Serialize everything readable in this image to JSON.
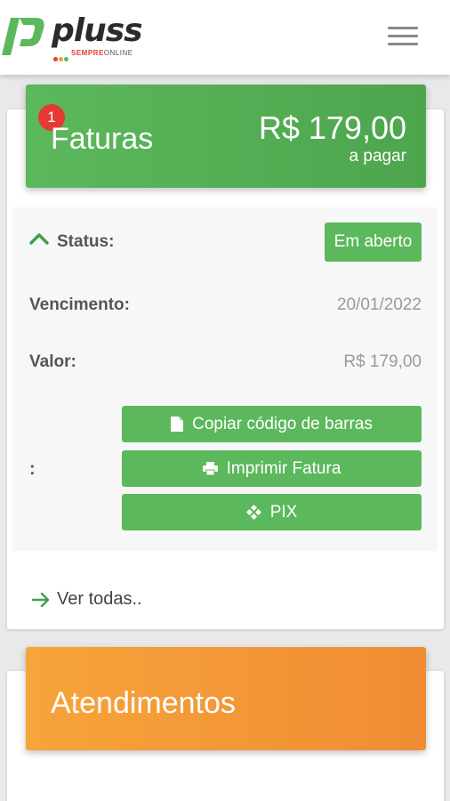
{
  "header": {
    "logo_text": "pluss",
    "logo_tagline_bold": "SEMPRE",
    "logo_tagline": "ONLINE",
    "brand_colors": {
      "green": "#5cb85c",
      "dark": "#2b2b2b",
      "red": "#e53935",
      "orange": "#f08c34"
    }
  },
  "faturas": {
    "badge_count": "1",
    "title": "Faturas",
    "amount": "R$ 179,00",
    "amount_sub": "a pagar",
    "status_label": "Status:",
    "status_value": "Em aberto",
    "vencimento_label": "Vencimento:",
    "vencimento_value": "20/01/2022",
    "valor_label": "Valor:",
    "valor_value": "R$ 179,00",
    "actions_label": ":",
    "actions": [
      {
        "label": "Copiar código de barras",
        "icon": "document-icon"
      },
      {
        "label": "Imprimir Fatura",
        "icon": "printer-icon"
      },
      {
        "label": "PIX",
        "icon": "pix-icon"
      }
    ],
    "see_all": "Ver todas.."
  },
  "atendimentos": {
    "title": "Atendimentos"
  }
}
